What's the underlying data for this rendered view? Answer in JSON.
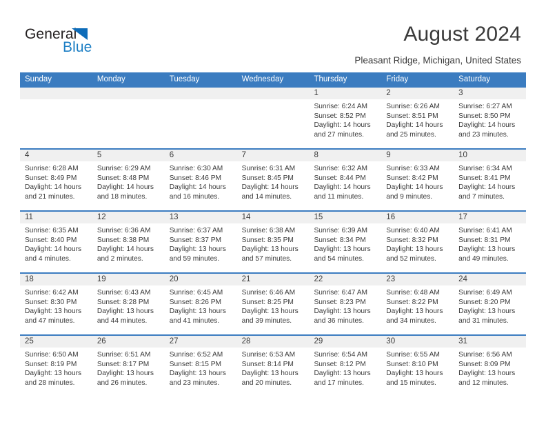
{
  "brand": {
    "word_one": "General",
    "word_two": "Blue",
    "triangle_color": "#0d6cb9",
    "text_color": "#1b7ec4"
  },
  "header": {
    "title": "August 2024",
    "subtitle": "Pleasant Ridge, Michigan, United States"
  },
  "theme": {
    "accent": "#3b7cc0",
    "band": "#f0f0f0",
    "text": "#3a3a3a"
  },
  "calendar": {
    "daynames": [
      "Sunday",
      "Monday",
      "Tuesday",
      "Wednesday",
      "Thursday",
      "Friday",
      "Saturday"
    ],
    "weeks": [
      [
        {
          "day": "",
          "l1": "",
          "l2": "",
          "l3": "",
          "l4": ""
        },
        {
          "day": "",
          "l1": "",
          "l2": "",
          "l3": "",
          "l4": ""
        },
        {
          "day": "",
          "l1": "",
          "l2": "",
          "l3": "",
          "l4": ""
        },
        {
          "day": "",
          "l1": "",
          "l2": "",
          "l3": "",
          "l4": ""
        },
        {
          "day": "1",
          "l1": "Sunrise: 6:24 AM",
          "l2": "Sunset: 8:52 PM",
          "l3": "Daylight: 14 hours",
          "l4": "and 27 minutes."
        },
        {
          "day": "2",
          "l1": "Sunrise: 6:26 AM",
          "l2": "Sunset: 8:51 PM",
          "l3": "Daylight: 14 hours",
          "l4": "and 25 minutes."
        },
        {
          "day": "3",
          "l1": "Sunrise: 6:27 AM",
          "l2": "Sunset: 8:50 PM",
          "l3": "Daylight: 14 hours",
          "l4": "and 23 minutes."
        }
      ],
      [
        {
          "day": "4",
          "l1": "Sunrise: 6:28 AM",
          "l2": "Sunset: 8:49 PM",
          "l3": "Daylight: 14 hours",
          "l4": "and 21 minutes."
        },
        {
          "day": "5",
          "l1": "Sunrise: 6:29 AM",
          "l2": "Sunset: 8:48 PM",
          "l3": "Daylight: 14 hours",
          "l4": "and 18 minutes."
        },
        {
          "day": "6",
          "l1": "Sunrise: 6:30 AM",
          "l2": "Sunset: 8:46 PM",
          "l3": "Daylight: 14 hours",
          "l4": "and 16 minutes."
        },
        {
          "day": "7",
          "l1": "Sunrise: 6:31 AM",
          "l2": "Sunset: 8:45 PM",
          "l3": "Daylight: 14 hours",
          "l4": "and 14 minutes."
        },
        {
          "day": "8",
          "l1": "Sunrise: 6:32 AM",
          "l2": "Sunset: 8:44 PM",
          "l3": "Daylight: 14 hours",
          "l4": "and 11 minutes."
        },
        {
          "day": "9",
          "l1": "Sunrise: 6:33 AM",
          "l2": "Sunset: 8:42 PM",
          "l3": "Daylight: 14 hours",
          "l4": "and 9 minutes."
        },
        {
          "day": "10",
          "l1": "Sunrise: 6:34 AM",
          "l2": "Sunset: 8:41 PM",
          "l3": "Daylight: 14 hours",
          "l4": "and 7 minutes."
        }
      ],
      [
        {
          "day": "11",
          "l1": "Sunrise: 6:35 AM",
          "l2": "Sunset: 8:40 PM",
          "l3": "Daylight: 14 hours",
          "l4": "and 4 minutes."
        },
        {
          "day": "12",
          "l1": "Sunrise: 6:36 AM",
          "l2": "Sunset: 8:38 PM",
          "l3": "Daylight: 14 hours",
          "l4": "and 2 minutes."
        },
        {
          "day": "13",
          "l1": "Sunrise: 6:37 AM",
          "l2": "Sunset: 8:37 PM",
          "l3": "Daylight: 13 hours",
          "l4": "and 59 minutes."
        },
        {
          "day": "14",
          "l1": "Sunrise: 6:38 AM",
          "l2": "Sunset: 8:35 PM",
          "l3": "Daylight: 13 hours",
          "l4": "and 57 minutes."
        },
        {
          "day": "15",
          "l1": "Sunrise: 6:39 AM",
          "l2": "Sunset: 8:34 PM",
          "l3": "Daylight: 13 hours",
          "l4": "and 54 minutes."
        },
        {
          "day": "16",
          "l1": "Sunrise: 6:40 AM",
          "l2": "Sunset: 8:32 PM",
          "l3": "Daylight: 13 hours",
          "l4": "and 52 minutes."
        },
        {
          "day": "17",
          "l1": "Sunrise: 6:41 AM",
          "l2": "Sunset: 8:31 PM",
          "l3": "Daylight: 13 hours",
          "l4": "and 49 minutes."
        }
      ],
      [
        {
          "day": "18",
          "l1": "Sunrise: 6:42 AM",
          "l2": "Sunset: 8:30 PM",
          "l3": "Daylight: 13 hours",
          "l4": "and 47 minutes."
        },
        {
          "day": "19",
          "l1": "Sunrise: 6:43 AM",
          "l2": "Sunset: 8:28 PM",
          "l3": "Daylight: 13 hours",
          "l4": "and 44 minutes."
        },
        {
          "day": "20",
          "l1": "Sunrise: 6:45 AM",
          "l2": "Sunset: 8:26 PM",
          "l3": "Daylight: 13 hours",
          "l4": "and 41 minutes."
        },
        {
          "day": "21",
          "l1": "Sunrise: 6:46 AM",
          "l2": "Sunset: 8:25 PM",
          "l3": "Daylight: 13 hours",
          "l4": "and 39 minutes."
        },
        {
          "day": "22",
          "l1": "Sunrise: 6:47 AM",
          "l2": "Sunset: 8:23 PM",
          "l3": "Daylight: 13 hours",
          "l4": "and 36 minutes."
        },
        {
          "day": "23",
          "l1": "Sunrise: 6:48 AM",
          "l2": "Sunset: 8:22 PM",
          "l3": "Daylight: 13 hours",
          "l4": "and 34 minutes."
        },
        {
          "day": "24",
          "l1": "Sunrise: 6:49 AM",
          "l2": "Sunset: 8:20 PM",
          "l3": "Daylight: 13 hours",
          "l4": "and 31 minutes."
        }
      ],
      [
        {
          "day": "25",
          "l1": "Sunrise: 6:50 AM",
          "l2": "Sunset: 8:19 PM",
          "l3": "Daylight: 13 hours",
          "l4": "and 28 minutes."
        },
        {
          "day": "26",
          "l1": "Sunrise: 6:51 AM",
          "l2": "Sunset: 8:17 PM",
          "l3": "Daylight: 13 hours",
          "l4": "and 26 minutes."
        },
        {
          "day": "27",
          "l1": "Sunrise: 6:52 AM",
          "l2": "Sunset: 8:15 PM",
          "l3": "Daylight: 13 hours",
          "l4": "and 23 minutes."
        },
        {
          "day": "28",
          "l1": "Sunrise: 6:53 AM",
          "l2": "Sunset: 8:14 PM",
          "l3": "Daylight: 13 hours",
          "l4": "and 20 minutes."
        },
        {
          "day": "29",
          "l1": "Sunrise: 6:54 AM",
          "l2": "Sunset: 8:12 PM",
          "l3": "Daylight: 13 hours",
          "l4": "and 17 minutes."
        },
        {
          "day": "30",
          "l1": "Sunrise: 6:55 AM",
          "l2": "Sunset: 8:10 PM",
          "l3": "Daylight: 13 hours",
          "l4": "and 15 minutes."
        },
        {
          "day": "31",
          "l1": "Sunrise: 6:56 AM",
          "l2": "Sunset: 8:09 PM",
          "l3": "Daylight: 13 hours",
          "l4": "and 12 minutes."
        }
      ]
    ]
  }
}
